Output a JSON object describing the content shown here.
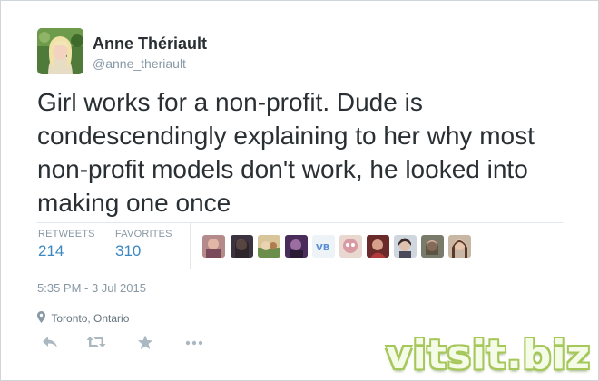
{
  "user": {
    "name": "Anne Thériault",
    "handle": "@anne_theriault"
  },
  "tweet": {
    "text": "Girl works for a non-profit. Dude is condescendingly explaining to her why most non-profit models don't work, he looked into making one once"
  },
  "stats": {
    "retweets_label": "RETWEETS",
    "retweets": "214",
    "favorites_label": "FAVORITES",
    "favorites": "310"
  },
  "favoriters": [
    {
      "icon": "avatar-1"
    },
    {
      "icon": "avatar-2"
    },
    {
      "icon": "avatar-3"
    },
    {
      "icon": "avatar-4"
    },
    {
      "icon": "avatar-5"
    },
    {
      "icon": "avatar-6"
    },
    {
      "icon": "avatar-7"
    },
    {
      "icon": "avatar-8"
    },
    {
      "icon": "avatar-9"
    },
    {
      "icon": "avatar-10"
    }
  ],
  "timestamp": "5:35 PM - 3 Jul 2015",
  "location": "Toronto, Ontario",
  "actions": {
    "reply_icon": "reply-icon",
    "retweet_icon": "retweet-icon",
    "favorite_icon": "star-icon",
    "more_icon": "more-icon"
  },
  "watermark": "vitsit.biz",
  "colors": {
    "link_blue": "#3b88c3",
    "muted_gray": "#8899a6",
    "text": "#292f33",
    "border": "#e1e8ed"
  }
}
